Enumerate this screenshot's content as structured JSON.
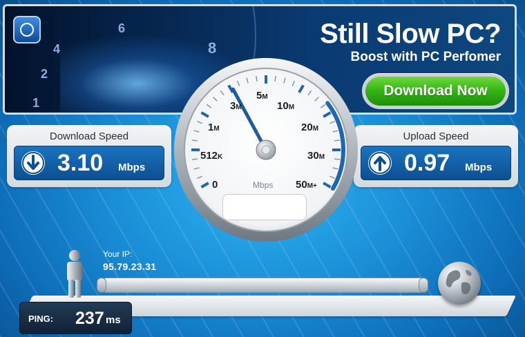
{
  "banner": {
    "title": "Still Slow PC?",
    "subtitle": "Boost with PC Perfomer",
    "download_label": "Download Now",
    "dial_numbers": [
      "1",
      "2",
      "4",
      "6",
      "8"
    ],
    "icon": "speedometer-icon"
  },
  "download": {
    "title": "Download Speed",
    "value": "3.10",
    "unit": "Mbps",
    "icon": "arrow-down-icon"
  },
  "upload": {
    "title": "Upload Speed",
    "value": "0.97",
    "unit": "Mbps",
    "icon": "arrow-up-icon"
  },
  "gauge": {
    "scale_labels": [
      {
        "num": "0",
        "suf": ""
      },
      {
        "num": "512",
        "suf": "K"
      },
      {
        "num": "1",
        "suf": "M"
      },
      {
        "num": "3",
        "suf": "M"
      },
      {
        "num": "5",
        "suf": "M"
      },
      {
        "num": "10",
        "suf": "M"
      },
      {
        "num": "20",
        "suf": "M"
      },
      {
        "num": "30",
        "suf": "M"
      },
      {
        "num": "50",
        "suf": "M+"
      }
    ],
    "unit": "Mbps",
    "needle_value_mbps": 3.1,
    "accent": "#1e66b0"
  },
  "connection": {
    "ip_label": "Your IP:",
    "ip": "95.79.23.31",
    "ping_label": "PING:",
    "ping_value": "237",
    "ping_unit": "ms",
    "person_icon": "person-icon",
    "globe_icon": "globe-icon"
  },
  "colors": {
    "background": "#1a8fd8",
    "button_green": "#33b313",
    "panel_blue": "#0c4f92"
  }
}
